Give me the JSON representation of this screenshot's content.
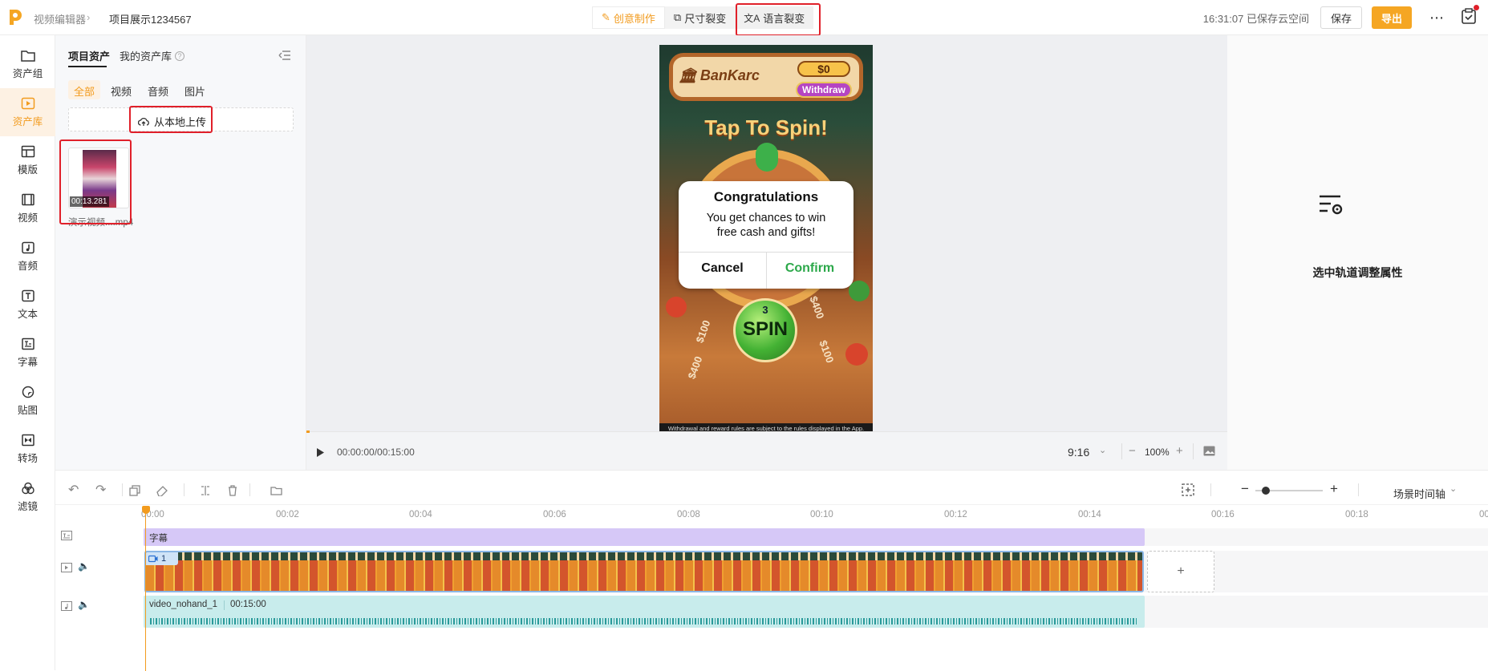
{
  "header": {
    "breadcrumb_root": "视频编辑器",
    "project_name": "项目展示1234567",
    "modes": [
      "创意制作",
      "尺寸裂变",
      "语言裂变"
    ],
    "save_status": "16:31:07 已保存云空间",
    "save_label": "保存",
    "export_label": "导出"
  },
  "leftnav": [
    "资产组",
    "资产库",
    "模版",
    "视频",
    "音频",
    "文本",
    "字幕",
    "贴图",
    "转场",
    "滤镜"
  ],
  "assets": {
    "tabs": [
      "项目资产",
      "我的资产库"
    ],
    "filters": [
      "全部",
      "视频",
      "音频",
      "图片"
    ],
    "upload_label": "从本地上传",
    "item": {
      "duration": "00:13.281",
      "name": "演示视频....mp4"
    }
  },
  "preview": {
    "brand": "BanKarc",
    "balance": "$0",
    "withdraw": "Withdraw",
    "tap_to_spin": "Tap To Spin!",
    "dialog_title": "Congratulations",
    "dialog_body_1": "You get chances to win",
    "dialog_body_2": "free cash and gifts!",
    "cancel": "Cancel",
    "confirm": "Confirm",
    "spin_count": "3",
    "spin": "SPIN",
    "wheel_labels": [
      "$100",
      "$400",
      "$400",
      "$100"
    ],
    "disclaimer": "Withdrawal and reward rules are subject to the rules displayed in the App.",
    "time": "00:00:00/00:15:00",
    "ratio": "9:16",
    "zoom": "100%"
  },
  "properties": {
    "hint": "选中轨道调整属性"
  },
  "timeline": {
    "ticks": [
      "00:00",
      "00:02",
      "00:04",
      "00:06",
      "00:08",
      "00:10",
      "00:12",
      "00:14",
      "00:16",
      "00:18",
      "00:"
    ],
    "scene_mode": "场景时间轴",
    "subtitle_label": "字幕",
    "video_index": "1",
    "audio_name": "video_nohand_1",
    "audio_duration": "00:15:00",
    "add": "+"
  },
  "colors": {
    "accent": "#f29b1e",
    "highlight": "#e0202a",
    "subtitle_track": "#d6c8f7",
    "audio_track": "#c8ecec",
    "video_track": "#e58a2a"
  }
}
